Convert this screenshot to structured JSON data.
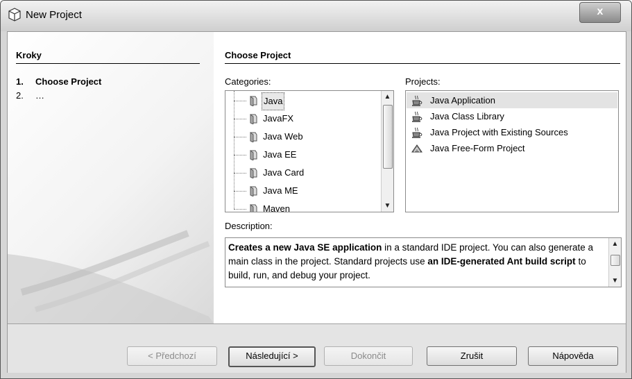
{
  "window": {
    "title": "New Project",
    "close_label": "x"
  },
  "steps": {
    "title": "Kroky",
    "items": [
      {
        "num": "1.",
        "label": "Choose Project"
      },
      {
        "num": "2.",
        "label": "…"
      }
    ]
  },
  "main": {
    "title": "Choose Project",
    "categories_label": "Categories:",
    "projects_label": "Projects:",
    "categories": [
      "Java",
      "JavaFX",
      "Java Web",
      "Java EE",
      "Java Card",
      "Java ME",
      "Maven"
    ],
    "selected_category": "Java",
    "projects": [
      "Java Application",
      "Java Class Library",
      "Java Project with Existing Sources",
      "Java Free-Form Project"
    ],
    "selected_project": "Java Application",
    "description_label": "Description:",
    "description": {
      "p1_bold": "Creates a new Java SE application",
      "p1_rest": " in a standard IDE project. You can also generate a main class in the project. Standard projects use ",
      "p2_bold": "an IDE-generated Ant build script",
      "p2_rest": " to build, run, and debug your project."
    }
  },
  "buttons": {
    "prev": "< Předchozí",
    "next": "Následující >",
    "finish": "Dokončit",
    "cancel": "Zrušit",
    "help": "Nápověda"
  },
  "icons": {
    "window": "netbeans-cube-icon",
    "folder": "folder-icon",
    "coffee": "java-coffee-cup-icon",
    "freeform": "java-freeform-icon"
  }
}
